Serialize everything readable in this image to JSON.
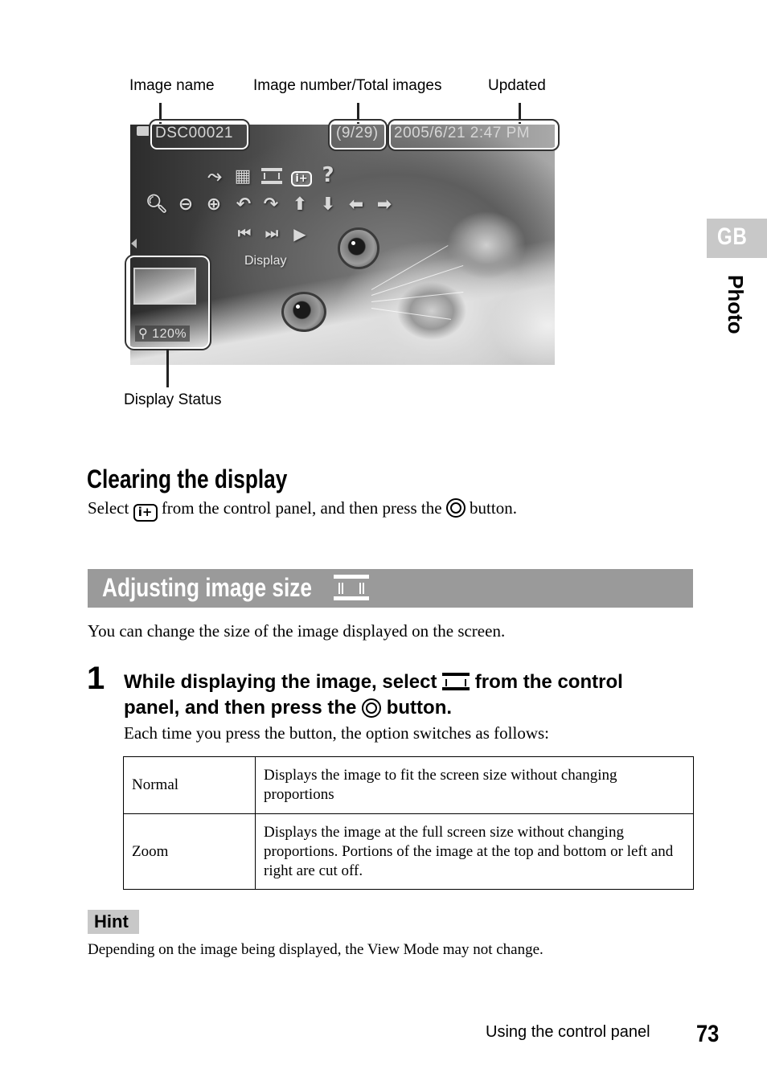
{
  "figure": {
    "callouts": {
      "image_name": "Image name",
      "image_number": "Image number/Total images",
      "updated": "Updated",
      "display_status": "Display Status"
    },
    "screen": {
      "file_name": "DSC00021",
      "image_counter": "(9/29)",
      "timestamp": "2005/6/21  2:47 PM",
      "control_panel": {
        "row1_icons": [
          "slideshow-icon",
          "slideshow-settings-icon",
          "image-size-icon",
          "clear-display-icon",
          "help-icon"
        ],
        "row2_icons": [
          "zoom-reset-icon",
          "zoom-out-icon",
          "zoom-in-icon",
          "rotate-left-icon",
          "rotate-right-icon",
          "scroll-up-icon",
          "scroll-down-icon",
          "scroll-left-icon",
          "scroll-right-icon"
        ],
        "row3_icons": [
          "previous-icon",
          "next-icon",
          "play-icon"
        ],
        "selected_label": "Display"
      },
      "zoom_level": "120%"
    }
  },
  "side_tab": {
    "region": "GB",
    "chapter": "Photo"
  },
  "clearing": {
    "title": "Clearing the display",
    "text_before_icon": "Select ",
    "icon_label": "i+",
    "text_middle": " from the control panel, and then press the ",
    "text_after": " button."
  },
  "adjusting": {
    "title": "Adjusting image size",
    "intro": "You can change the size of the image displayed on the screen.",
    "step": {
      "number": "1",
      "line1_before": "While displaying the image, select ",
      "line1_after": " from the control",
      "line2_before": "panel, and then press the ",
      "line2_after": " button.",
      "note": "Each time you press the button, the option switches as follows:"
    },
    "table": [
      {
        "mode": "Normal",
        "description": "Displays the image to fit the screen size without changing proportions"
      },
      {
        "mode": "Zoom",
        "description": "Displays the image at the full screen size without changing proportions. Portions of the image at the top and bottom or left and right are cut off."
      }
    ]
  },
  "hint": {
    "label": "Hint",
    "text": "Depending on the image being displayed, the View Mode may not change."
  },
  "footer": {
    "section": "Using the control panel",
    "page_number": "73"
  }
}
